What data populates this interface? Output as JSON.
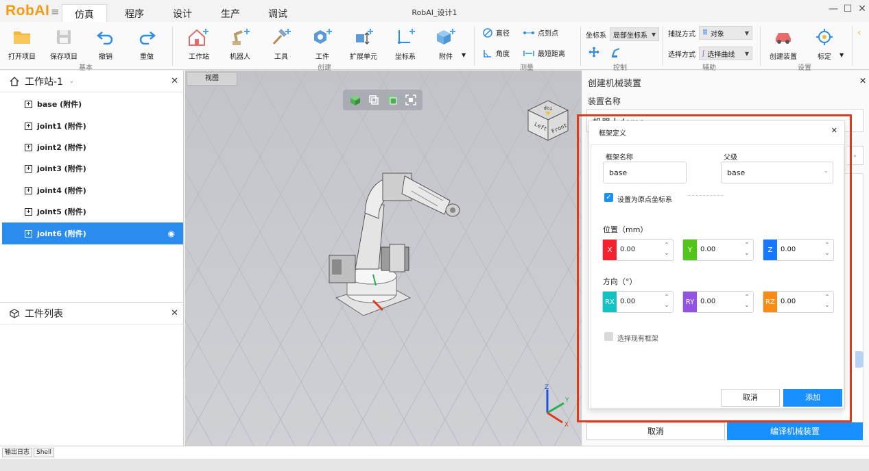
{
  "app": {
    "logo": "RobAI",
    "window_title": "RobAI_设计1"
  },
  "menu": {
    "tabs": [
      {
        "label": "仿真",
        "active": true
      },
      {
        "label": "程序",
        "active": false
      },
      {
        "label": "设计",
        "active": false
      },
      {
        "label": "生产",
        "active": false
      },
      {
        "label": "调试",
        "active": false
      }
    ]
  },
  "window_controls": {
    "minimize": "—",
    "maximize": "☐",
    "close": "✕"
  },
  "ribbon": {
    "basic": {
      "group": "基本",
      "open": "打开项目",
      "save": "保存项目",
      "undo": "撤销",
      "redo": "重做"
    },
    "create": {
      "group": "创建",
      "station": "工作站",
      "robot": "机器人",
      "tool": "工具",
      "workpiece": "工件",
      "ext_unit": "扩展单元",
      "coord": "坐标系",
      "attachment": "附件"
    },
    "measure": {
      "group": "测量",
      "diameter": "直径",
      "point_to_point": "点到点",
      "angle": "角度",
      "min_distance": "最短距离"
    },
    "control": {
      "group": "控制",
      "coord_label": "坐标系",
      "coord_value": "局部坐标系"
    },
    "assist": {
      "group": "辅助",
      "capture_label": "捕捉方式",
      "capture_value": "对象",
      "select_label": "选择方式",
      "select_value": "选择曲线"
    },
    "settings": {
      "group": "设置",
      "create_device": "创建装置",
      "calibrate": "标定"
    }
  },
  "station_panel": {
    "title": "工作站-1",
    "items": [
      {
        "label": "base (附件)",
        "selected": false
      },
      {
        "label": "joint1 (附件)",
        "selected": false
      },
      {
        "label": "joint2 (附件)",
        "selected": false
      },
      {
        "label": "joint3 (附件)",
        "selected": false
      },
      {
        "label": "joint4 (附件)",
        "selected": false
      },
      {
        "label": "joint5 (附件)",
        "selected": false
      },
      {
        "label": "joint6 (附件)",
        "selected": true
      }
    ]
  },
  "workpiece_panel": {
    "title": "工件列表"
  },
  "viewport": {
    "tab": "视图",
    "view_cube": {
      "top": "Top",
      "left": "Left",
      "front": "Front"
    },
    "axes": {
      "x": "X",
      "y": "Y",
      "z": "Z"
    }
  },
  "right_panel": {
    "title": "创建机械装置",
    "device_name_label": "装置名称",
    "device_name_value": "机器人demo",
    "cancel": "取消",
    "compile": "编译机械装置"
  },
  "frame_dialog": {
    "title": "框架定义",
    "frame_name_label": "框架名称",
    "frame_name_value": "base",
    "parent_label": "父级",
    "parent_value": "base",
    "set_origin_label": "设置为原点坐标系",
    "set_origin_checked": true,
    "position_label": "位置（mm）",
    "position": [
      {
        "axis": "X",
        "value": "0.00",
        "color": "#f5222d"
      },
      {
        "axis": "Y",
        "value": "0.00",
        "color": "#52c41a"
      },
      {
        "axis": "Z",
        "value": "0.00",
        "color": "#1677ff"
      }
    ],
    "orientation_label": "方向（°）",
    "orientation": [
      {
        "axis": "RX",
        "value": "0.00",
        "color": "#13c2c2"
      },
      {
        "axis": "RY",
        "value": "0.00",
        "color": "#9254de"
      },
      {
        "axis": "RZ",
        "value": "0.00",
        "color": "#fa8c16"
      }
    ],
    "select_existing_label": "选择现有框架",
    "select_existing_checked": false,
    "cancel": "取消",
    "add": "添加"
  },
  "bottom_tabs": [
    "输出日志",
    "Shell"
  ],
  "colors": {
    "accent": "#1890ff",
    "selection": "#2b8cf0",
    "highlight": "#e03a1e",
    "logo": "#f39c12"
  }
}
